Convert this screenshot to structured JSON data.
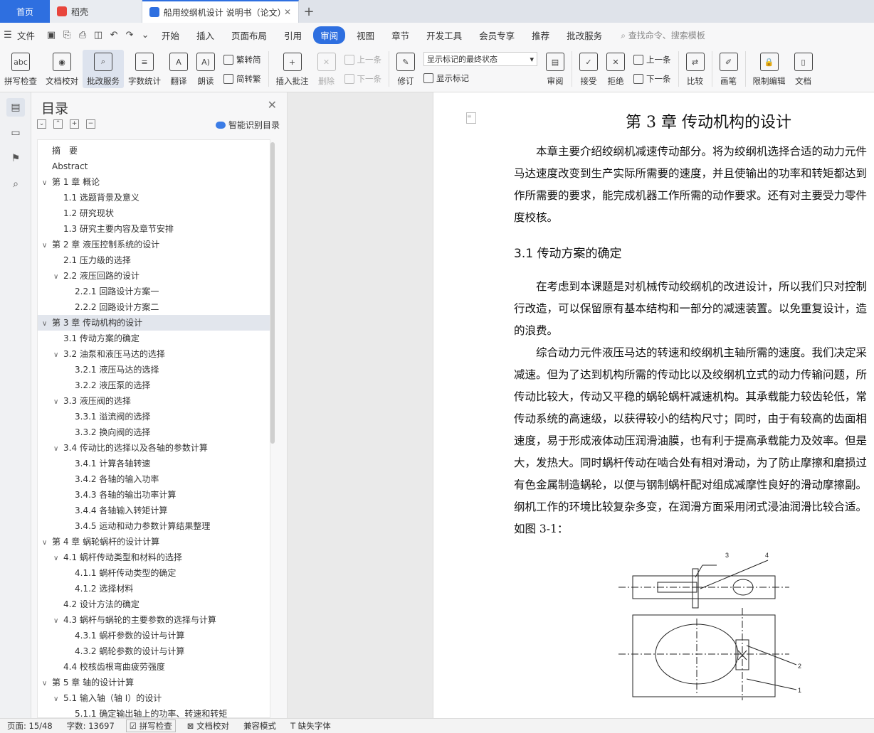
{
  "tabs": {
    "home": "首页",
    "docer": "稻壳",
    "doc": "船用绞纲机设计 说明书（论文）"
  },
  "menu": {
    "file": "文件",
    "items": [
      "开始",
      "插入",
      "页面布局",
      "引用",
      "审阅",
      "视图",
      "章节",
      "开发工具",
      "会员专享",
      "推荐",
      "批改服务"
    ],
    "active": "审阅",
    "search": "查找命令、搜索模板"
  },
  "ribbon": {
    "spell": "拼写检查",
    "proof": "文档校对",
    "review_service": "批改服务",
    "wordcount": "字数统计",
    "translate": "翻译",
    "read": "朗读",
    "trad": "繁转简",
    "simp": "简转繁",
    "add_comment": "插入批注",
    "delete": "删除",
    "prev_comment": "上一条",
    "next_comment": "下一条",
    "track": "修订",
    "markup_state": "显示标记的最终状态",
    "show_markup": "显示标记",
    "review_pane": "审阅",
    "accept": "接受",
    "reject": "拒绝",
    "prev": "上一条",
    "next": "下一条",
    "compare": "比较",
    "ink": "画笔",
    "restrict": "限制编辑",
    "doc_more": "文档"
  },
  "nav": {
    "title": "目录",
    "smart": "智能识别目录"
  },
  "toc": [
    {
      "t": "摘　要",
      "lv": 0,
      "car": ""
    },
    {
      "t": "Abstract",
      "lv": 0,
      "car": ""
    },
    {
      "t": "第 1 章  概论",
      "lv": 0,
      "car": "∨"
    },
    {
      "t": "1.1 选题背景及意义",
      "lv": 1,
      "car": ""
    },
    {
      "t": "1.2 研究现状",
      "lv": 1,
      "car": ""
    },
    {
      "t": "1.3 研究主要内容及章节安排",
      "lv": 1,
      "car": ""
    },
    {
      "t": "第 2 章  液压控制系统的设计",
      "lv": 0,
      "car": "∨"
    },
    {
      "t": "2.1 压力级的选择",
      "lv": 1,
      "car": ""
    },
    {
      "t": "2.2  液压回路的设计",
      "lv": 1,
      "car": "∨"
    },
    {
      "t": "2.2.1  回路设计方案一",
      "lv": 2,
      "car": ""
    },
    {
      "t": "2.2.2  回路设计方案二",
      "lv": 2,
      "car": ""
    },
    {
      "t": "第 3 章  传动机构的设计",
      "lv": 0,
      "car": "∨",
      "sel": true
    },
    {
      "t": "3.1 传动方案的确定",
      "lv": 1,
      "car": ""
    },
    {
      "t": "3.2 油泵和液压马达的选择",
      "lv": 1,
      "car": "∨"
    },
    {
      "t": "3.2.1  液压马达的选择",
      "lv": 2,
      "car": ""
    },
    {
      "t": "3.2.2  液压泵的选择",
      "lv": 2,
      "car": ""
    },
    {
      "t": "3.3  液压阀的选择",
      "lv": 1,
      "car": "∨"
    },
    {
      "t": "3.3.1 溢流阀的选择",
      "lv": 2,
      "car": ""
    },
    {
      "t": "3.3.2  换向阀的选择",
      "lv": 2,
      "car": ""
    },
    {
      "t": "3.4    传动比的选择以及各轴的参数计算",
      "lv": 1,
      "car": "∨"
    },
    {
      "t": "3.4.1    计算各轴转速",
      "lv": 2,
      "car": ""
    },
    {
      "t": "3.4.2    各轴的输入功率",
      "lv": 2,
      "car": ""
    },
    {
      "t": "3.4.3    各轴的输出功率计算",
      "lv": 2,
      "car": ""
    },
    {
      "t": "3.4.4    各轴输入转矩计算",
      "lv": 2,
      "car": ""
    },
    {
      "t": "3.4.5 运动和动力参数计算结果整理",
      "lv": 2,
      "car": ""
    },
    {
      "t": "第 4 章    蜗轮蜗杆的设计计算",
      "lv": 0,
      "car": "∨"
    },
    {
      "t": "4.1    蜗杆传动类型和材料的选择",
      "lv": 1,
      "car": "∨"
    },
    {
      "t": "4.1.1    蜗杆传动类型的确定",
      "lv": 2,
      "car": ""
    },
    {
      "t": "4.1.2    选择材料",
      "lv": 2,
      "car": ""
    },
    {
      "t": "4.2  设计方法的确定",
      "lv": 1,
      "car": ""
    },
    {
      "t": "4.3    蜗杆与蜗轮的主要参数的选择与计算",
      "lv": 1,
      "car": "∨"
    },
    {
      "t": "4.3.1    蜗杆参数的设计与计算",
      "lv": 2,
      "car": ""
    },
    {
      "t": "4.3.2    蜗轮参数的设计与计算",
      "lv": 2,
      "car": ""
    },
    {
      "t": "4.4    校核齿根弯曲疲劳强度",
      "lv": 1,
      "car": ""
    },
    {
      "t": "第 5 章    轴的设计计算",
      "lv": 0,
      "car": "∨"
    },
    {
      "t": "5.1    输入轴（轴 I）的设计",
      "lv": 1,
      "car": "∨"
    },
    {
      "t": "5.1.1    确定输出轴上的功率、转速和转矩",
      "lv": 2,
      "car": ""
    }
  ],
  "doc": {
    "chapter": "第 3 章  传动机构的设计",
    "p1": [
      "　　本章主要介绍绞纲机减速传动部分。将为绞纲机选择合适的动力元件",
      "马达速度改变到生产实际所需要的速度，并且使输出的功率和转矩都达到",
      "作所需要的要求，能完成机器工作所需的动作要求。还有对主要受力零件",
      "度校核。"
    ],
    "sec": "3.1 传动方案的确定",
    "p2": [
      "　　在考虑到本课题是对机械传动绞纲机的改进设计，所以我们只对控制",
      "行改造，可以保留原有基本结构和一部分的减速装置。以免重复设计，造",
      "的浪费。",
      "　　综合动力元件液压马达的转速和绞纲机主轴所需的速度。我们决定采",
      "减速。但为了达到机构所需的传动比以及绞纲机立式的动力传输问题，所",
      "传动比较大，传动又平稳的蜗轮蜗杆减速机构。其承载能力较齿轮低，常",
      "传动系统的高速级，以获得较小的结构尺寸；同时，由于有较高的齿面相",
      "速度，易于形成液体动压润滑油膜，也有利于提高承载能力及效率。但是",
      "大，发热大。同时蜗杆传动在啮合处有相对滑动，为了防止摩擦和磨损过",
      "有色金属制造蜗轮，以便与钢制蜗杆配对组成减摩性良好的滑动摩擦副。",
      "纲机工作的环境比较复杂多变，在润滑方面采用闭式浸油润滑比较合适。",
      "如图 3-1："
    ],
    "fig_labels": [
      "3",
      "4",
      "2",
      "1"
    ]
  },
  "status": {
    "page": "页面: 15/48",
    "words": "字数: 13697",
    "spell": "拼写检查",
    "proof": "文档校对",
    "compat": "兼容模式",
    "font": "缺失字体"
  }
}
